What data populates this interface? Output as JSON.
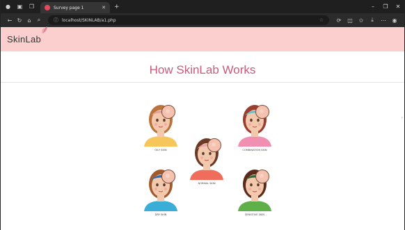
{
  "browser": {
    "tab_title": "Survey page 1",
    "url": "localhost/SKINLAB/a1.php"
  },
  "site": {
    "logo": "SkinLab",
    "heading": "How SkinLab Works"
  },
  "faces": [
    {
      "label": "OILY SKIN",
      "hair": "#b9733b",
      "shirt": "#f6c65a",
      "band": "#e3a1a1"
    },
    {
      "label": "COMBINATION SKIN",
      "hair": "#9b3c2f",
      "shirt": "#f08fb2",
      "band": "#73c0c9"
    },
    {
      "label": "NORMAL SKIN",
      "hair": "#6b3a26",
      "shirt": "#f06d5b",
      "band": "#e9a3a3"
    },
    {
      "label": "DRY SKIN",
      "hair": "#a05a2c",
      "shirt": "#3aaed6",
      "band": "#2e6bb3"
    },
    {
      "label": "SENSITIVE SKIN",
      "hair": "#5a2b1a",
      "shirt": "#5fb04a",
      "band": "#2e6b3a"
    }
  ],
  "colors": {
    "header_bg": "#fccfcf",
    "heading": "#c85a7a",
    "skin": "#f3c9ad"
  }
}
